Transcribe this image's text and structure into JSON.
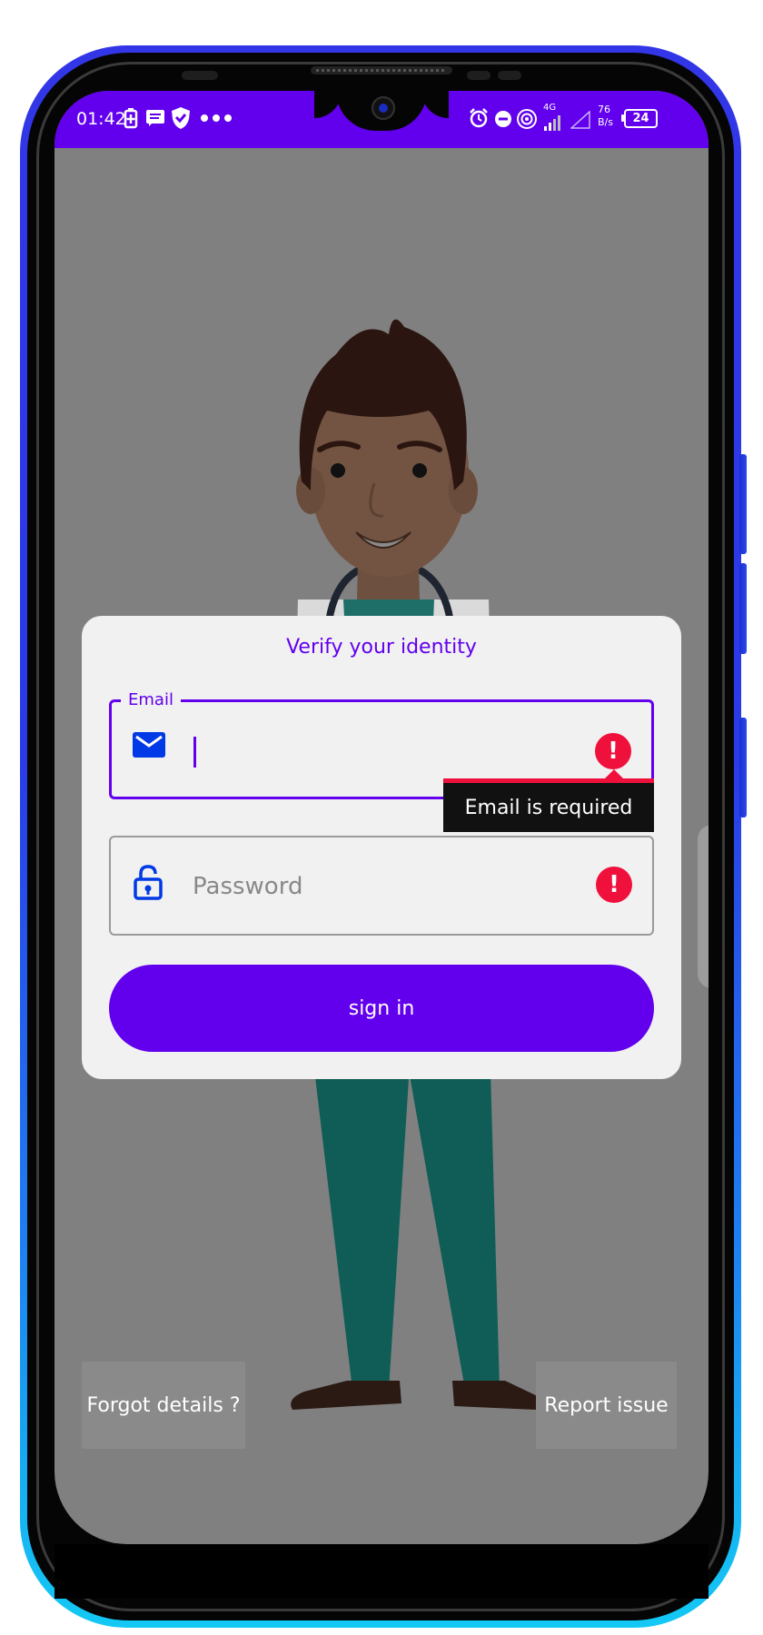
{
  "status_bar": {
    "time": "01:42",
    "network": "4G",
    "speed_value": "76",
    "speed_unit": "B/s",
    "battery": "24",
    "bar_color": "#6200ee"
  },
  "dialog": {
    "title": "Verify your identity",
    "email": {
      "label": "Email",
      "value": "",
      "icon": "mail-icon",
      "error_tooltip": "Email is required"
    },
    "password": {
      "placeholder": "Password",
      "value": "",
      "icon": "lock-open-icon"
    },
    "signin_label": "sign in"
  },
  "footer": {
    "forgot_label": "Forgot details ?",
    "report_label": "Report issue"
  },
  "colors": {
    "accent": "#6200ee",
    "error": "#f0103c",
    "icon_blue": "#0039e6"
  }
}
